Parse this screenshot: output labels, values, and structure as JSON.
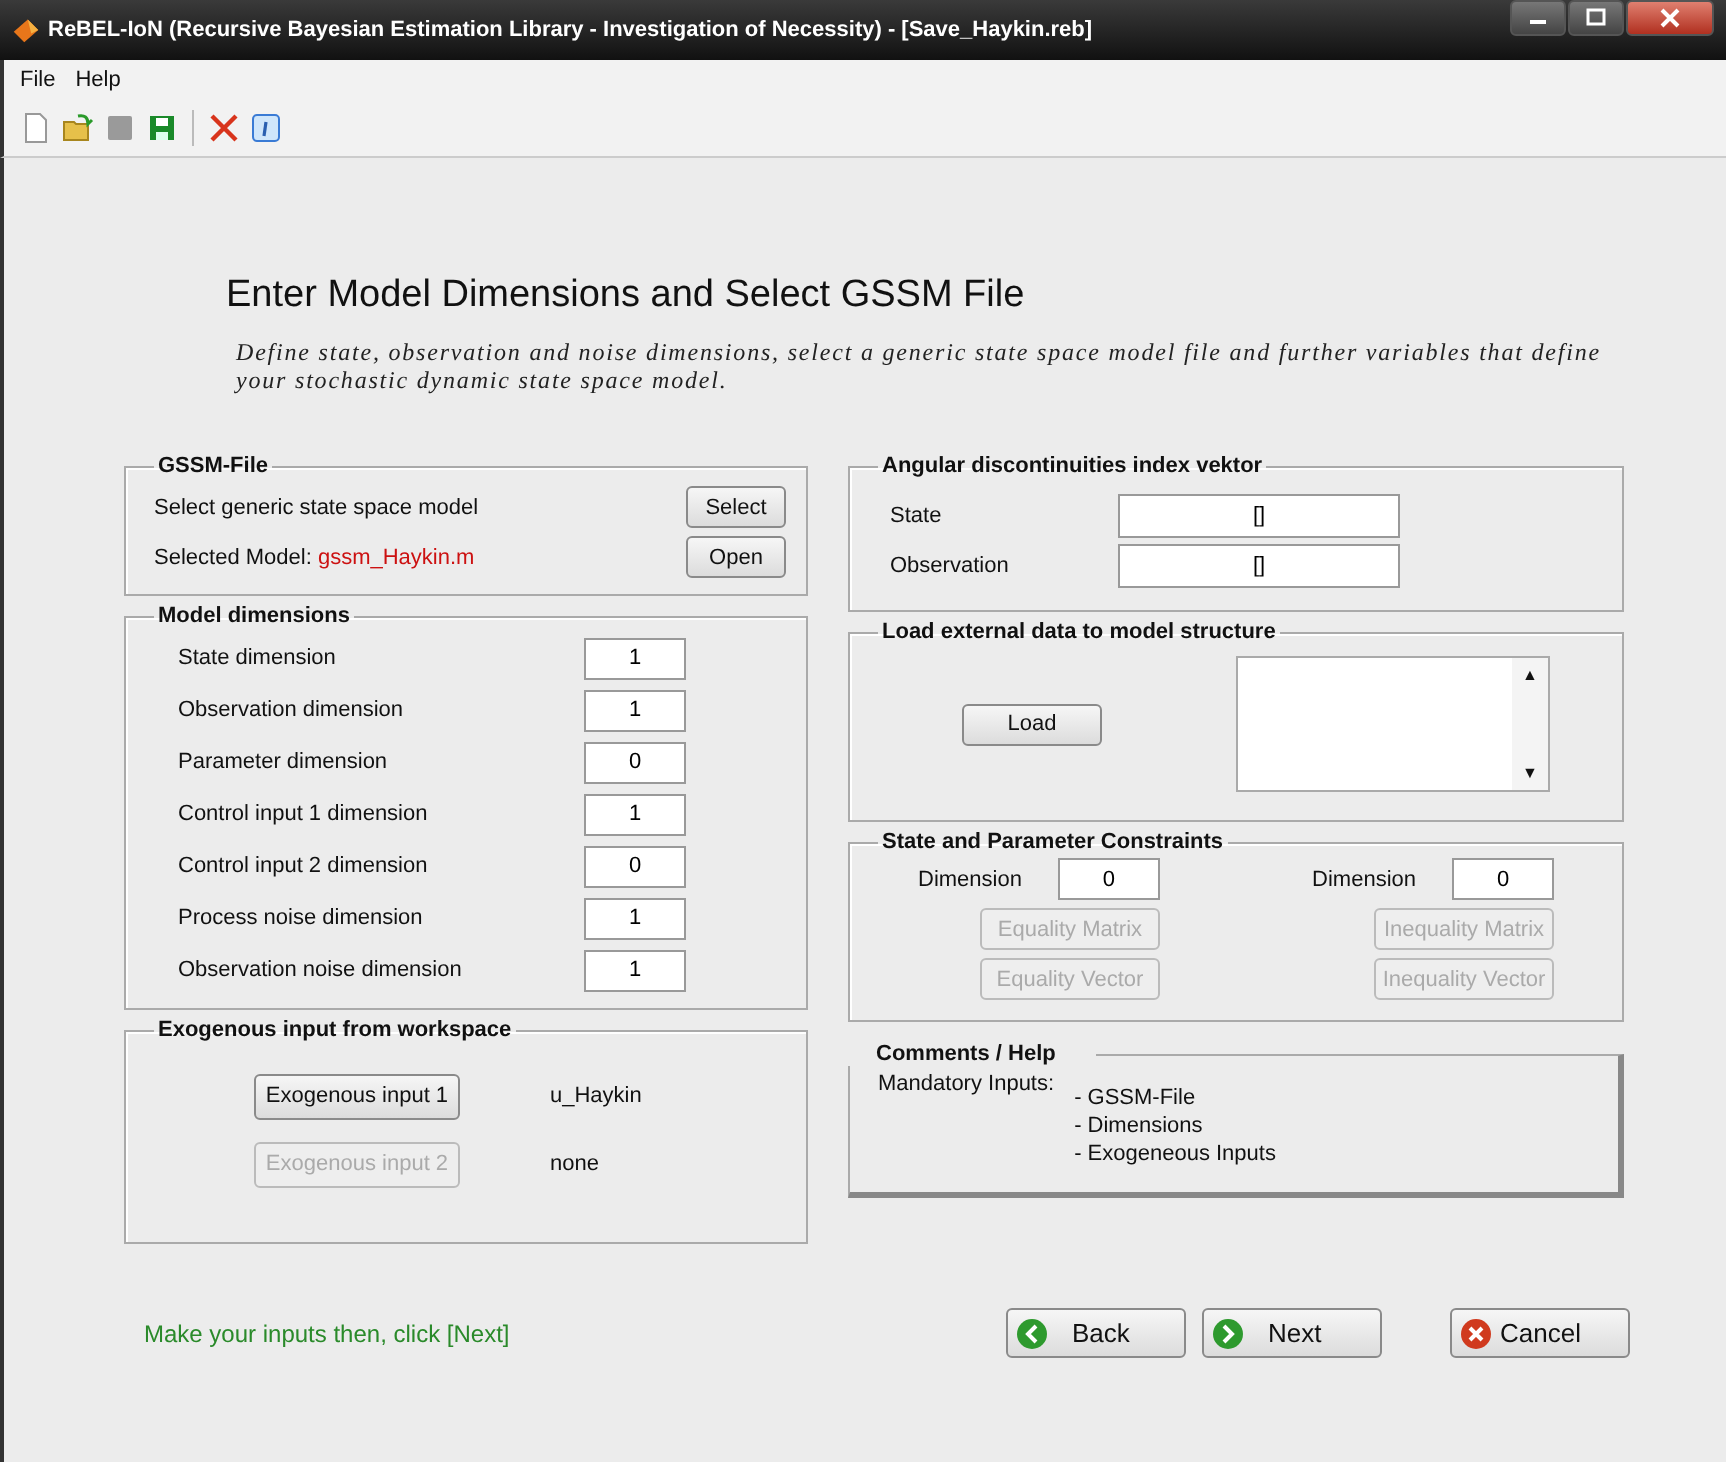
{
  "window": {
    "title": "ReBEL-IoN (Recursive Bayesian Estimation Library - Investigation of Necessity) - [Save_Haykin.reb]"
  },
  "menu": [
    "File",
    "Help"
  ],
  "heading": "Enter Model Dimensions and Select GSSM File",
  "description": "Define state, observation and noise dimensions, select a generic state space model file and further variables that define your stochastic dynamic state space model.",
  "gssm_file": {
    "title": "GSSM-File",
    "select_label": "Select generic state space model",
    "select_button": "Select",
    "selected_label": "Selected Model:",
    "selected_value": "gssm_Haykin.m",
    "open_button": "Open"
  },
  "model_dimensions": {
    "title": "Model dimensions",
    "fields": [
      {
        "label": "State dimension",
        "value": "1"
      },
      {
        "label": "Observation dimension",
        "value": "1"
      },
      {
        "label": "Parameter dimension",
        "value": "0"
      },
      {
        "label": "Control input 1 dimension",
        "value": "1"
      },
      {
        "label": "Control input 2 dimension",
        "value": "0"
      },
      {
        "label": "Process noise dimension",
        "value": "1"
      },
      {
        "label": "Observation noise dimension",
        "value": "1"
      }
    ]
  },
  "exogenous": {
    "title": "Exogenous input from workspace",
    "inputs": [
      {
        "button": "Exogenous input 1",
        "value": "u_Haykin",
        "disabled": false
      },
      {
        "button": "Exogenous input 2",
        "value": "none",
        "disabled": true
      }
    ]
  },
  "angular": {
    "title": "Angular discontinuities index vektor",
    "fields": [
      {
        "label": "State",
        "value": "[]"
      },
      {
        "label": "Observation",
        "value": "[]"
      }
    ]
  },
  "load": {
    "title": "Load external data to model structure",
    "button": "Load",
    "scroll_up": "▲",
    "scroll_down": "▼"
  },
  "constraints": {
    "title": "State and Parameter Constraints",
    "groups": [
      {
        "label": "Dimension",
        "value": "0",
        "buttons": [
          {
            "label": "Equality Matrix",
            "disabled": true
          },
          {
            "label": "Equality Vector",
            "disabled": true
          }
        ]
      },
      {
        "label": "Dimension",
        "value": "0",
        "buttons": [
          {
            "label": "Inequality Matrix",
            "disabled": true
          },
          {
            "label": "Inequality Vector",
            "disabled": true
          }
        ]
      }
    ]
  },
  "comments": {
    "title": "Comments / Help",
    "label": "Mandatory Inputs:",
    "items": [
      "- GSSM-File",
      "- Dimensions",
      "- Exogeneous Inputs"
    ]
  },
  "status": "Make your inputs then, click [Next]",
  "nav": [
    {
      "label": "Back",
      "kind": "back"
    },
    {
      "label": "Next",
      "kind": "next"
    },
    {
      "label": "Cancel",
      "kind": "cancel"
    }
  ]
}
